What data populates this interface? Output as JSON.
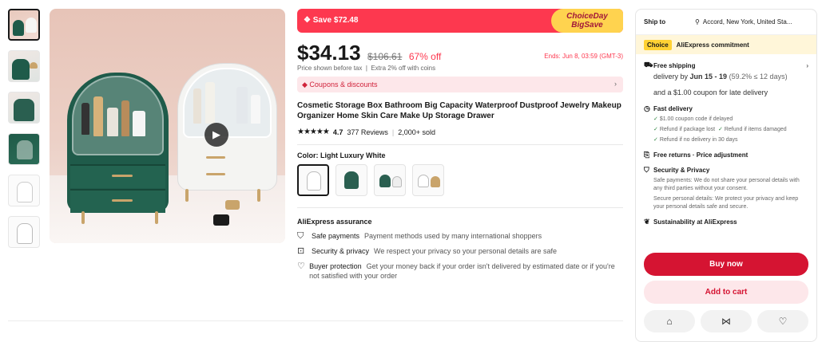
{
  "save_banner": {
    "icon": "tag-icon",
    "text": "Save $72.48",
    "choice_day": "ChoiceDay",
    "big_save": "BigSave"
  },
  "price": {
    "current": "$34.13",
    "original": "$106.61",
    "discount": "67% off",
    "ends": "Ends: Jun 8, 03:59 (GMT-3)",
    "note1": "Price shown before tax",
    "note2": "Extra 2% off with coins"
  },
  "coupons": {
    "label": "Coupons & discounts"
  },
  "product": {
    "title": "Cosmetic Storage Box Bathroom Big Capacity Waterproof Dustproof Jewelry Makeup Organizer Home Skin Care Make Up Storage Drawer",
    "stars": "★★★★★",
    "rating": "4.7",
    "reviews": "377 Reviews",
    "sold": "2,000+ sold"
  },
  "color": {
    "label": "Color: Light Luxury White"
  },
  "assurance": {
    "title": "AliExpress assurance",
    "items": [
      {
        "name": "Safe payments",
        "text": "Payment methods used by many international shoppers"
      },
      {
        "name": "Security & privacy",
        "text": "We respect your privacy so your personal details are safe"
      },
      {
        "name": "Buyer protection",
        "text": "Get your money back if your order isn't delivered by estimated date or if you're not satisfied with your order"
      }
    ]
  },
  "panel": {
    "ship_label": "Ship to",
    "ship_location": "Accord, New York, United Sta...",
    "choice_tag": "Choice",
    "commitment": "AliExpress commitment",
    "free_shipping": "Free shipping",
    "delivery_prefix": "delivery by",
    "delivery_dates": "Jun 15 - 19",
    "delivery_pct": "(59.2% ≤ 12 days)",
    "late_coupon": "and a $1.00 coupon for late delivery",
    "fast_delivery": "Fast delivery",
    "fd_1": "$1.00 coupon code if delayed",
    "fd_2": "Refund if package lost",
    "fd_3": "Refund if items damaged",
    "fd_4": "Refund if no delivery in 30 days",
    "free_returns": "Free returns · Price adjustment",
    "security_title": "Security & Privacy",
    "security_1": "Safe payments: We do not share your personal details with any third parties without your consent.",
    "security_2": "Secure personal details: We protect your privacy and keep your personal details safe and secure.",
    "sustainability": "Sustainability at AliExpress",
    "buy_now": "Buy now",
    "add_to_cart": "Add to cart"
  },
  "colors": {
    "brand_red": "#fd384f",
    "buy_red": "#d51432",
    "choice_yellow": "#ffd234"
  }
}
